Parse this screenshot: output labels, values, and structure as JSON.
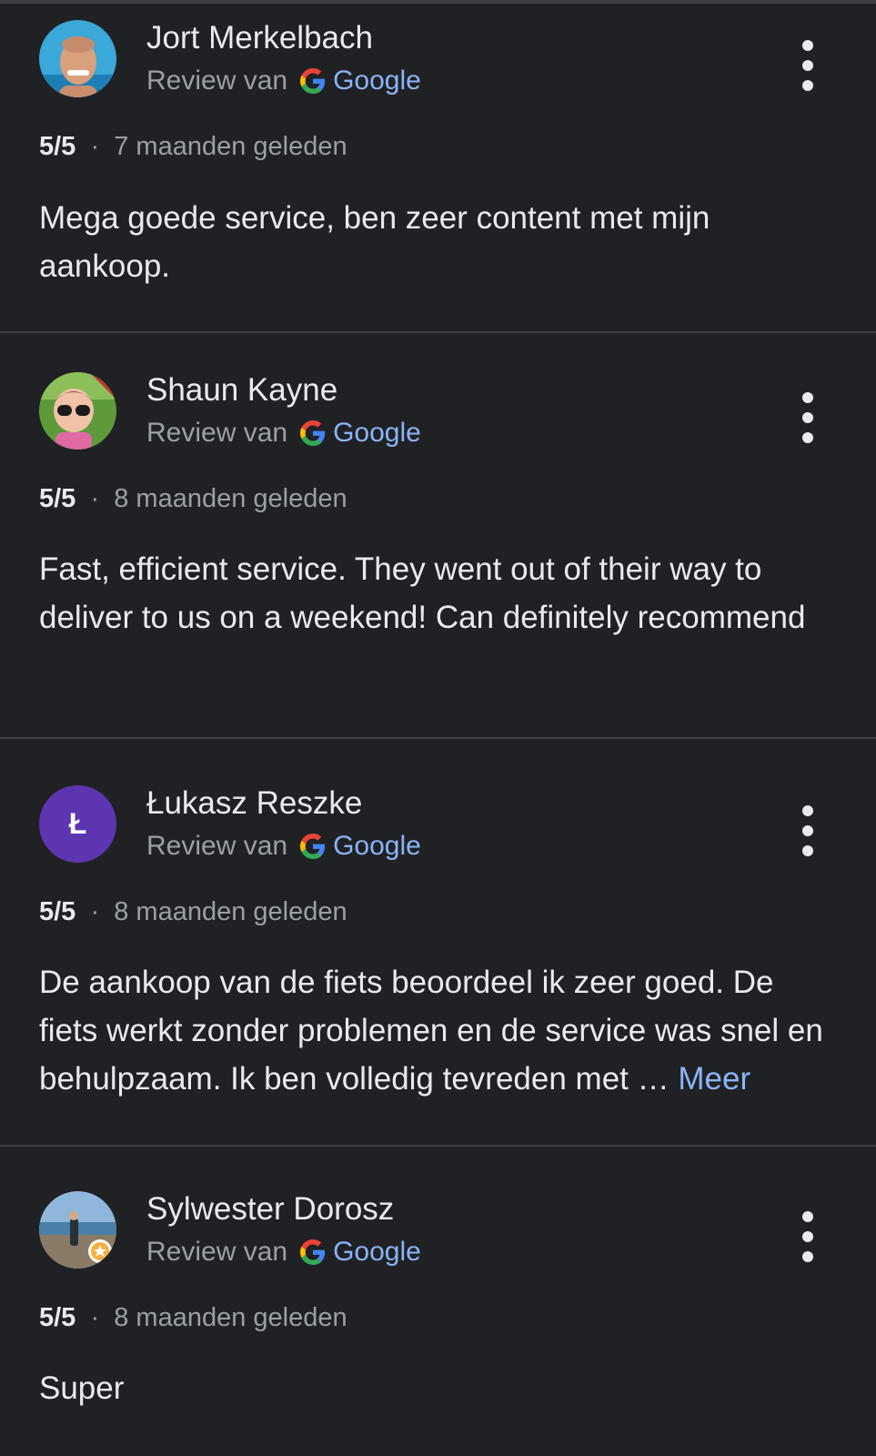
{
  "source_prefix": "Review van",
  "source_name": "Google",
  "more_label": "Meer",
  "separator": "·",
  "colors": {
    "background": "#202124",
    "divider": "#3c4043",
    "link": "#8ab4f8",
    "letter_avatar": "#5e35b1"
  },
  "icons": {
    "google": "google-g-logo",
    "menu": "more-vert-icon"
  },
  "reviews": [
    {
      "author": "Jort Merkelbach",
      "avatar": "photo",
      "rating": "5/5",
      "time": "7 maanden geleden",
      "text": "Mega goede service, ben zeer content met mijn aankoop."
    },
    {
      "author": "Shaun Kayne",
      "avatar": "photo",
      "rating": "5/5",
      "time": "8 maanden geleden",
      "text": "Fast, efficient service. They went out of their way to deliver to us on a weekend! Can definitely recommend"
    },
    {
      "author": "Łukasz Reszke",
      "avatar": "letter",
      "avatar_letter": "Ł",
      "rating": "5/5",
      "time": "8 maanden geleden",
      "text": "De aankoop van de fiets beoordeel ik zeer goed. De fiets werkt zonder problemen en de service was snel en behulpzaam. Ik ben volledig tevreden met …",
      "truncated": true
    },
    {
      "author": "Sylwester Dorosz",
      "avatar": "photo",
      "rating": "5/5",
      "time": "8 maanden geleden",
      "text": "Super"
    }
  ]
}
